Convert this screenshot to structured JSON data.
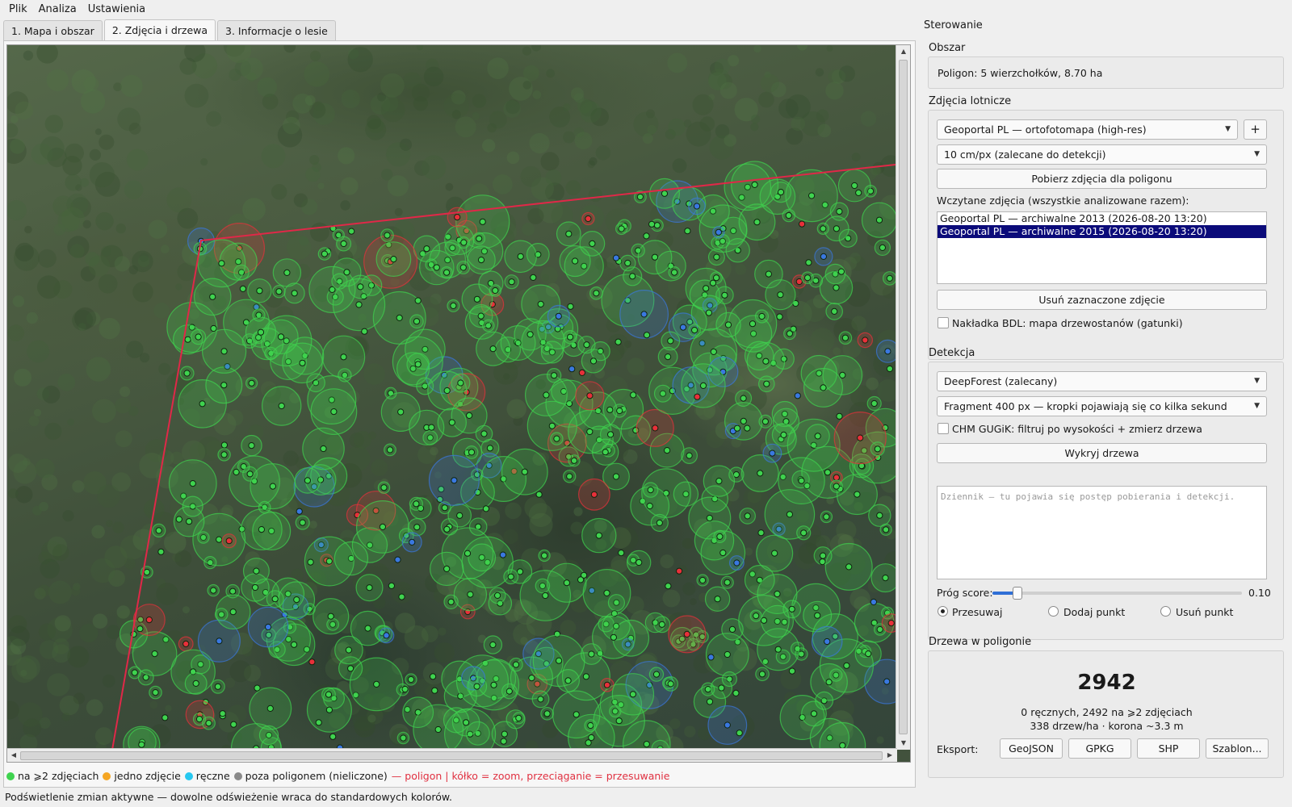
{
  "menu": [
    {
      "label": "Plik"
    },
    {
      "label": "Analiza"
    },
    {
      "label": "Ustawienia"
    }
  ],
  "tabs": [
    {
      "label": "1. Mapa i obszar",
      "active": false
    },
    {
      "label": "2. Zdjęcia i drzewa",
      "active": true
    },
    {
      "label": "3. Informacje o lesie",
      "active": false
    }
  ],
  "colors": {
    "accent_green": "#3fd34f",
    "marker_blue": "#3a78e0",
    "marker_red": "#e8303a",
    "polygon": "#e02848",
    "legend_orange": "#f5a623",
    "legend_cyan": "#27c8f0",
    "legend_gray": "#8a8a8a",
    "selection": "#0b0b7a",
    "slider": "#2f6fd6"
  },
  "legend": {
    "items": [
      {
        "color": "#3fd34f",
        "label": "na ⩾2 zdjęciach"
      },
      {
        "color": "#f5a623",
        "label": "jedno zdjęcie"
      },
      {
        "color": "#27c8f0",
        "label": "ręczne"
      },
      {
        "color": "#8a8a8a",
        "label": "poza poligonem (nieliczone)"
      }
    ],
    "polygon_label": "— poligon | kółko = zoom, przeciąganie = przesuwanie"
  },
  "status": "Podświetlenie zmian aktywne — dowolne odświeżenie wraca do standardowych kolorów.",
  "panel": {
    "title": "Sterowanie",
    "area": {
      "label": "Obszar",
      "polygon_info": "Poligon: 5 wierzchołków, 8.70 ha"
    },
    "photos": {
      "label": "Zdjęcia lotnicze",
      "source": "Geoportal PL — ortofotomapa (high-res)",
      "add_button": "+",
      "resolution": "10 cm/px (zalecane do detekcji)",
      "download_button": "Pobierz zdjęcia dla poligonu",
      "loaded_label": "Wczytane zdjęcia (wszystkie analizowane razem):",
      "loaded": [
        {
          "label": "Geoportal PL — archiwalne 2013 (2026-08-20 13:20)",
          "selected": false
        },
        {
          "label": "Geoportal PL — archiwalne 2015 (2026-08-20 13:20)",
          "selected": true
        }
      ],
      "remove_button": "Usuń zaznaczone zdjęcie",
      "bdl_overlay": {
        "label": "Nakładka BDL: mapa drzewostanów (gatunki)",
        "checked": false
      }
    },
    "detection": {
      "label": "Detekcja",
      "model": "DeepForest (zalecany)",
      "fragment": "Fragment 400 px — kropki pojawiają się co kilka sekund",
      "chm": {
        "label": "CHM GUGiK: filtruj po wysokości + zmierz drzewa",
        "checked": false
      },
      "detect_button": "Wykryj drzewa",
      "log_placeholder": "Dziennik — tu pojawia się postęp pobierania i detekcji.",
      "threshold_label": "Próg score:",
      "threshold_value": "0.10",
      "threshold_fraction": 0.1,
      "modes": [
        {
          "label": "Przesuwaj",
          "checked": true
        },
        {
          "label": "Dodaj punkt",
          "checked": false
        },
        {
          "label": "Usuń punkt",
          "checked": false
        }
      ]
    },
    "trees": {
      "label": "Drzewa w poligonie",
      "count": "2942",
      "summary1": "0 ręcznych, 2492 na ⩾2 zdjęciach",
      "summary2": "338 drzew/ha · korona ~3.3 m",
      "export_label": "Eksport:",
      "export_buttons": [
        "GeoJSON",
        "GPKG",
        "SHP",
        "Szablon..."
      ]
    }
  }
}
